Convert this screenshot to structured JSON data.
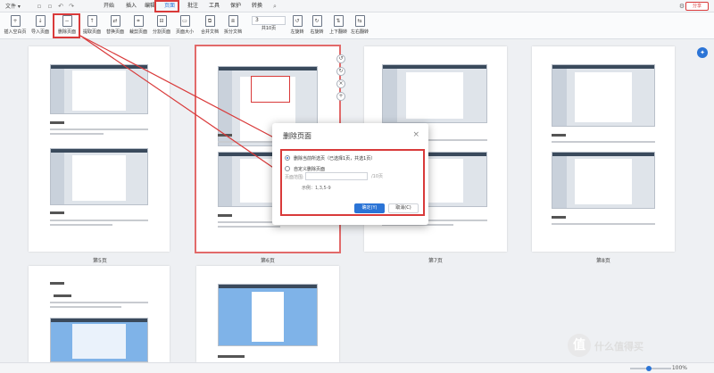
{
  "menubar": {
    "file_label": "文件 ▾",
    "tabs": [
      {
        "label": "开始"
      },
      {
        "label": "插入"
      },
      {
        "label": "编辑"
      },
      {
        "label": "页面"
      },
      {
        "label": "批注"
      },
      {
        "label": "工具"
      },
      {
        "label": "保护"
      },
      {
        "label": "转换"
      }
    ],
    "active_tab": "页面",
    "share_label": "分享"
  },
  "ribbon": {
    "tools": [
      {
        "label": "插入空白页",
        "icon": "insert-blank-page-icon"
      },
      {
        "label": "导入页面",
        "icon": "import-page-icon"
      },
      {
        "label": "删除页面",
        "icon": "delete-page-icon"
      },
      {
        "label": "提取页面",
        "icon": "extract-page-icon"
      },
      {
        "label": "替换页面",
        "icon": "replace-page-icon"
      },
      {
        "label": "裁剪页面",
        "icon": "crop-page-icon"
      },
      {
        "label": "分割页面",
        "icon": "split-page-icon"
      },
      {
        "label": "页面大小",
        "icon": "page-size-icon"
      },
      {
        "label": "合并文档",
        "icon": "merge-doc-icon"
      },
      {
        "label": "拆分文档",
        "icon": "split-doc-icon"
      },
      {
        "label": "共10页",
        "icon": "page-count-icon"
      },
      {
        "label": "左旋转",
        "icon": "rotate-left-icon"
      },
      {
        "label": "右旋转",
        "icon": "rotate-right-icon"
      },
      {
        "label": "上下翻转",
        "icon": "flip-vertical-icon"
      },
      {
        "label": "左右翻转",
        "icon": "flip-horizontal-icon"
      }
    ],
    "page_input_value": "3"
  },
  "pages": [
    {
      "label": "第5页"
    },
    {
      "label": "第6页"
    },
    {
      "label": "第7页"
    },
    {
      "label": "第8页"
    },
    {
      "label": ""
    },
    {
      "label": ""
    }
  ],
  "dialog": {
    "title": "删除页面",
    "option_selected": "删除当前所选页（已选择1页，共选1页）",
    "option_custom": "自定义删除页面",
    "range_label": "页面范围:",
    "range_total": "/10页",
    "example": "示例：1,3,5-9",
    "ok_label": "确定(Y)",
    "cancel_label": "取消(C)"
  },
  "statusbar": {
    "zoom": "100%"
  },
  "watermark": {
    "badge": "值",
    "text": "什么值得买"
  },
  "colors": {
    "accent": "#2b74d6",
    "highlight": "#d93a3a"
  }
}
